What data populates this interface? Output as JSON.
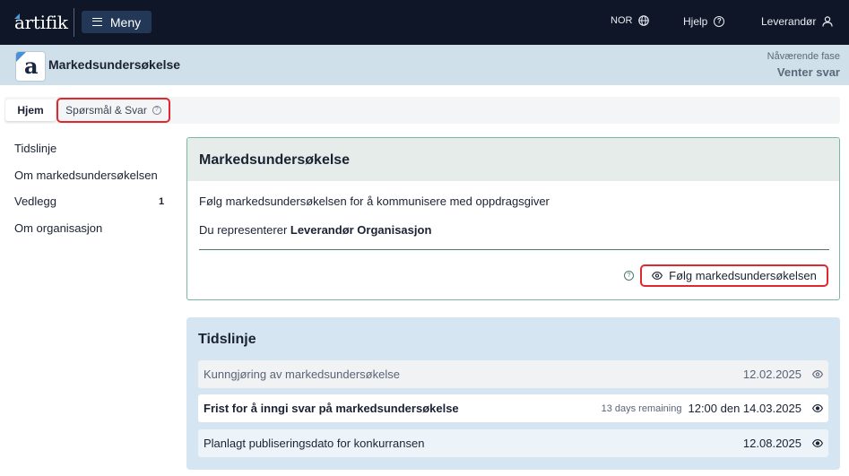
{
  "topbar": {
    "logo_text": "artifik",
    "menu_label": "Meny",
    "language": "NOR",
    "help_label": "Hjelp",
    "user_label": "Leverandør"
  },
  "project": {
    "logo_letter": "a",
    "title": "Markedsundersøkelse",
    "phase_label": "Nåværende fase",
    "phase_value": "Venter svar"
  },
  "tabs": [
    {
      "label": "Hjem",
      "active": true
    },
    {
      "label": "Spørsmål & Svar",
      "active": false
    }
  ],
  "sidebar": {
    "items": [
      {
        "label": "Tidslinje"
      },
      {
        "label": "Om markedsundersøkelsen"
      },
      {
        "label": "Vedlegg",
        "count": "1"
      },
      {
        "label": "Om organisasjon"
      }
    ]
  },
  "market_card": {
    "title": "Markedsundersøkelse",
    "description": "Følg markedsundersøkelsen for å kommunisere med oppdragsgiver",
    "represent_prefix": "Du representerer ",
    "organisation": "Leverandør Organisasjon",
    "follow_label": "Følg markedsundersøkelsen"
  },
  "timeline": {
    "title": "Tidslinje",
    "rows": [
      {
        "name": "Kunngjøring av markedsundersøkelse",
        "remaining": "",
        "date": "12.02.2025"
      },
      {
        "name": "Frist for å inngi svar på markedsundersøkelse",
        "remaining": "13 days remaining",
        "date": "12:00 den 14.03.2025"
      },
      {
        "name": "Planlagt publiseringsdato for konkurransen",
        "remaining": "",
        "date": "12.08.2025"
      }
    ]
  },
  "colors": {
    "topbar": "#0e1628",
    "project_bar": "#cfe0ea",
    "highlight": "#e0282e",
    "card_border": "#7ab8a2",
    "timeline_bg": "#d5e5f1"
  }
}
